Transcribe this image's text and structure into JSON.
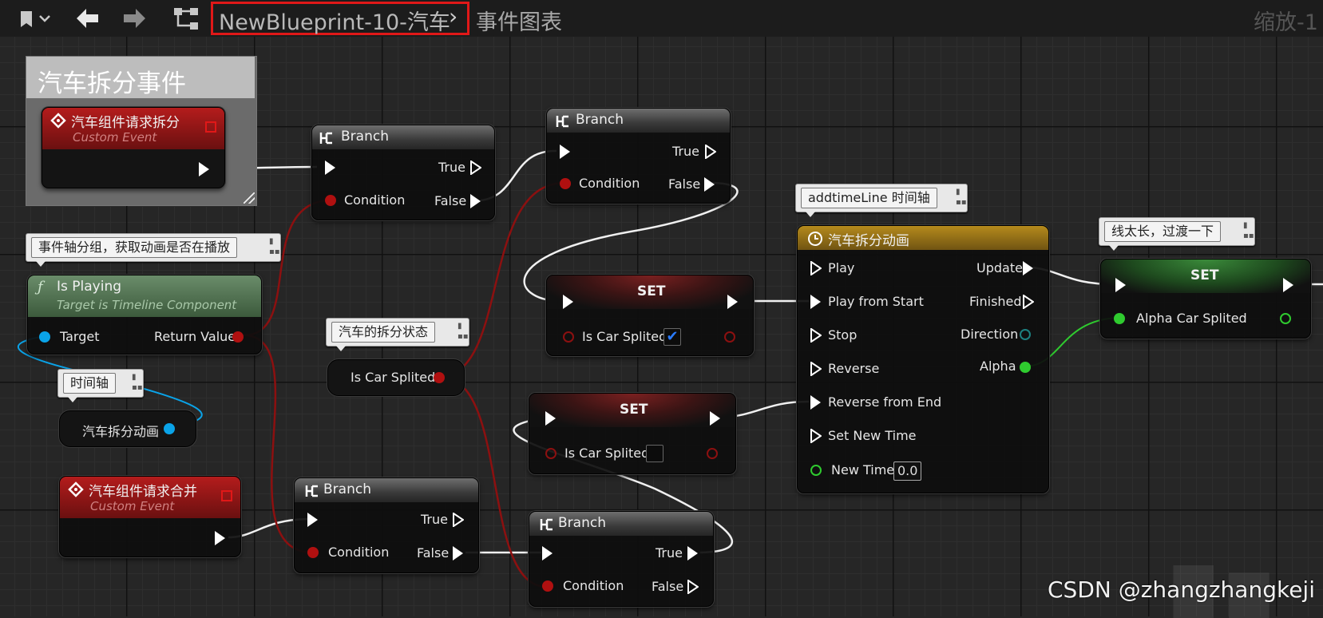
{
  "toolbar": {
    "bookmark_icon": "bookmark-icon",
    "back_icon": "arrow-left-icon",
    "forward_icon": "arrow-right-icon",
    "hierarchy_icon": "graph-hierarchy-icon",
    "blueprint_name": "NewBlueprint-10-汽车",
    "chevron": "›",
    "graph_name": "事件图表",
    "zoom": "缩放-1"
  },
  "comment": {
    "title": "汽车拆分事件"
  },
  "nodes": {
    "event_split": {
      "title": "汽车组件请求拆分",
      "subtitle": "Custom Event"
    },
    "event_merge": {
      "title": "汽车组件请求合并",
      "subtitle": "Custom Event"
    },
    "branch1": {
      "title": "Branch",
      "true": "True",
      "false": "False",
      "condition": "Condition"
    },
    "branch2": {
      "title": "Branch",
      "true": "True",
      "false": "False",
      "condition": "Condition"
    },
    "branch3": {
      "title": "Branch",
      "true": "True",
      "false": "False",
      "condition": "Condition"
    },
    "branch4": {
      "title": "Branch",
      "true": "True",
      "false": "False",
      "condition": "Condition"
    },
    "is_playing": {
      "title": "Is Playing",
      "subtitle": "Target is Timeline Component",
      "target": "Target",
      "return": "Return Value"
    },
    "timeline_var": {
      "label": "汽车拆分动画"
    },
    "is_car_splited_var": {
      "label": "Is Car Splited"
    },
    "set_true": {
      "title": "SET",
      "var": "Is Car Splited",
      "checked": "✔"
    },
    "set_false": {
      "title": "SET",
      "var": "Is Car Splited"
    },
    "timeline": {
      "title": "汽车拆分动画",
      "inputs": [
        "Play",
        "Play from Start",
        "Stop",
        "Reverse",
        "Reverse from End",
        "Set New Time",
        "New Time"
      ],
      "outputs": [
        "Update",
        "Finished",
        "Direction",
        "Alpha"
      ],
      "new_time_value": "0.0"
    },
    "set_alpha": {
      "title": "SET",
      "var": "Alpha Car Splited"
    }
  },
  "comments": {
    "is_playing_note": "事件轴分组，获取动画是否在播放",
    "timeline_var_note": "时间轴",
    "split_state_note": "汽车的拆分状态",
    "timeline_note": "addtimeLine 时间轴",
    "set_alpha_note": "线太长，过渡一下"
  },
  "watermark": "CSDN @zhangzhangkeji",
  "colors": {
    "exec": "#ffffff",
    "bool": "#9c0d0d",
    "object": "#0aa3e8",
    "float": "#2fcb2f",
    "struct": "#1d8080"
  }
}
